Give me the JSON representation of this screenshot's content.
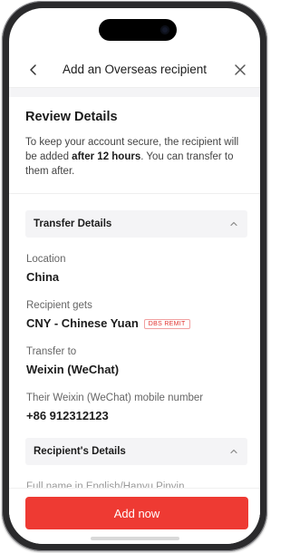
{
  "header": {
    "title": "Add an Overseas recipient"
  },
  "review": {
    "title": "Review Details",
    "message_before": "To keep your account secure, the recipient will be added ",
    "message_bold": "after 12 hours",
    "message_after": ". You can transfer to them after."
  },
  "transfer_details": {
    "section_title": "Transfer Details",
    "location_label": "Location",
    "location_value": "China",
    "recipient_gets_label": "Recipient gets",
    "recipient_gets_value": "CNY - Chinese Yuan",
    "badge": "DBS REMIT",
    "transfer_to_label": "Transfer to",
    "transfer_to_value": "Weixin (WeChat)",
    "mobile_label": "Their Weixin (WeChat) mobile number",
    "mobile_value": "+86 912312123"
  },
  "recipient_details": {
    "section_title": "Recipient's Details",
    "partial_label": "Full name in English/Hanyu Pinyin"
  },
  "footer": {
    "add_label": "Add now"
  },
  "colors": {
    "accent": "#ee3a33",
    "section_bg": "#f4f4f6"
  }
}
